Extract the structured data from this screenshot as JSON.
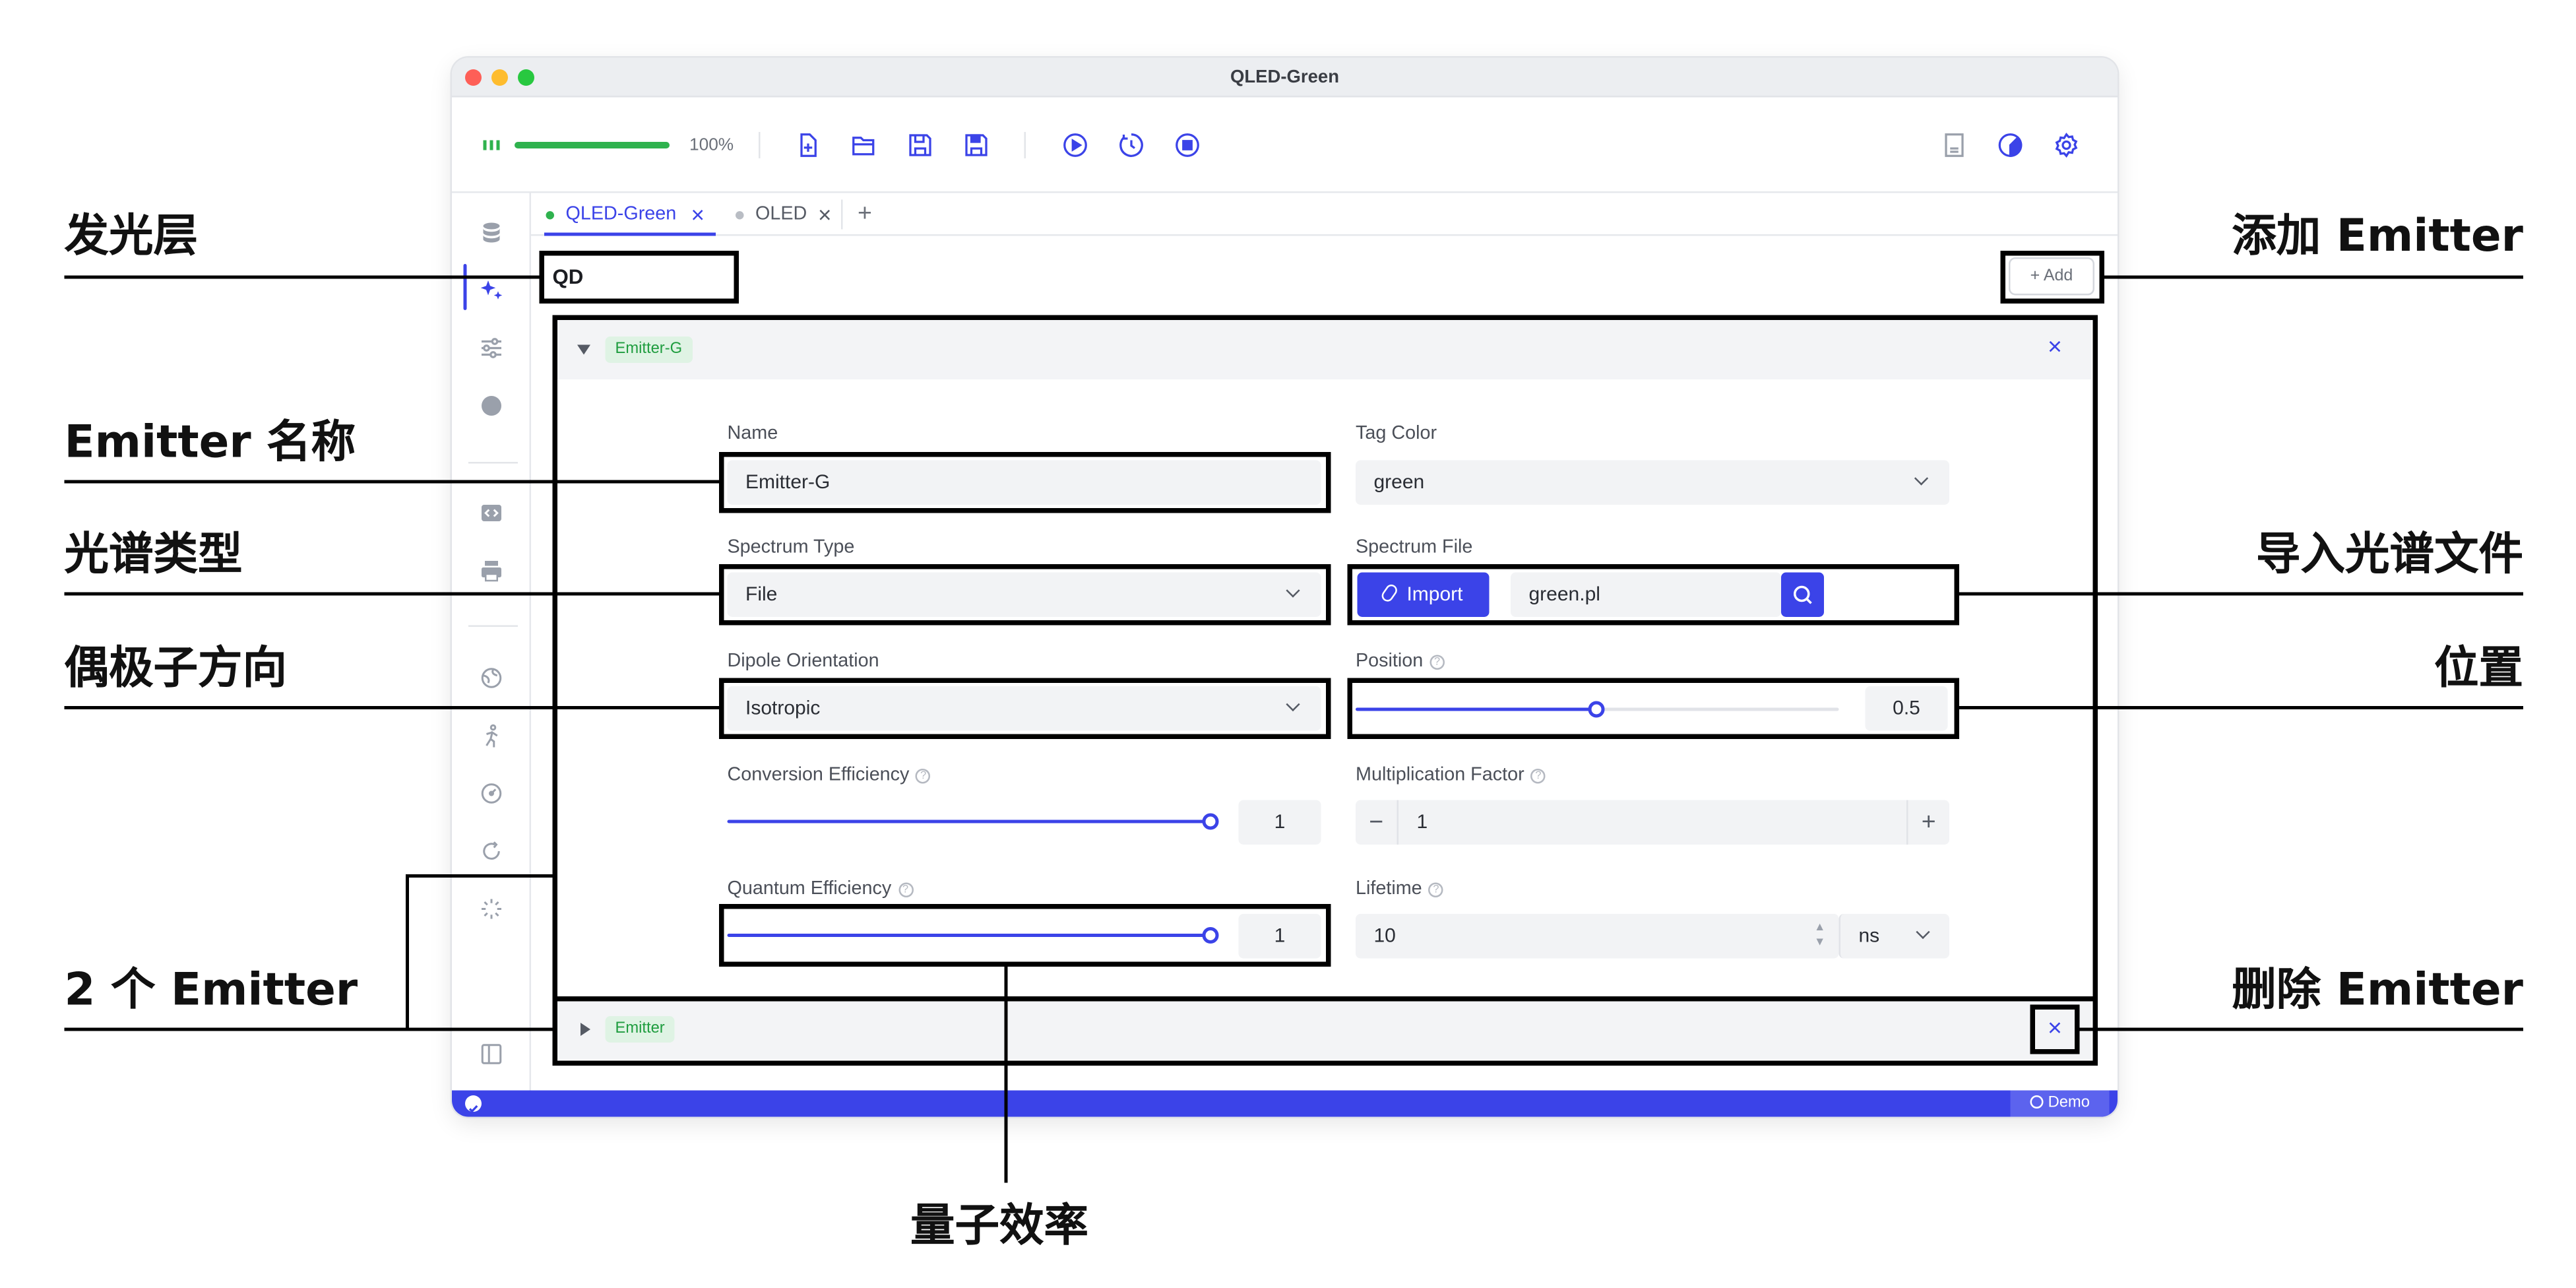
{
  "window": {
    "title": "QLED-Green"
  },
  "toolbar": {
    "zoom": "100%",
    "progress": 1.0
  },
  "tabs": [
    {
      "label": "QLED-Green",
      "active": true,
      "dot_color": "#2fb24e"
    },
    {
      "label": "OLED",
      "active": false,
      "dot_color": "#b9bdc4"
    }
  ],
  "layer": {
    "name": "QD",
    "add_label": "+ Add"
  },
  "emitters": [
    {
      "tag": "Emitter-G",
      "expanded": true,
      "fields": {
        "name_label": "Name",
        "name_value": "Emitter-G",
        "tag_color_label": "Tag Color",
        "tag_color_value": "green",
        "spectrum_type_label": "Spectrum Type",
        "spectrum_type_value": "File",
        "spectrum_file_label": "Spectrum File",
        "import_label": "Import",
        "spectrum_file_value": "green.pl",
        "dipole_label": "Dipole Orientation",
        "dipole_value": "Isotropic",
        "position_label": "Position",
        "position_value": "0.5",
        "conversion_label": "Conversion Efficiency",
        "conversion_value": "1",
        "multiplication_label": "Multiplication Factor",
        "multiplication_value": "1",
        "quantum_label": "Quantum Efficiency",
        "quantum_value": "1",
        "lifetime_label": "Lifetime",
        "lifetime_value": "10",
        "lifetime_unit": "ns"
      }
    },
    {
      "tag": "Emitter",
      "expanded": false
    }
  ],
  "status": {
    "demo_label": "Demo"
  },
  "annotations": {
    "emissive_layer": "发光层",
    "emitter_name": "Emitter 名称",
    "spectrum_type": "光谱类型",
    "dipole": "偶极子方向",
    "two_emitters": "2 个 Emitter",
    "add_emitter": "添加 Emitter",
    "import_spectrum": "导入光谱文件",
    "position": "位置",
    "delete_emitter": "删除 Emitter",
    "quantum_efficiency": "量子效率"
  },
  "colors": {
    "accent": "#3b43e8",
    "tag_green": "#1f9d3f",
    "tag_bg": "#dff3e4",
    "progress": "#2fb24e",
    "status_bar": "#3b43e8"
  }
}
